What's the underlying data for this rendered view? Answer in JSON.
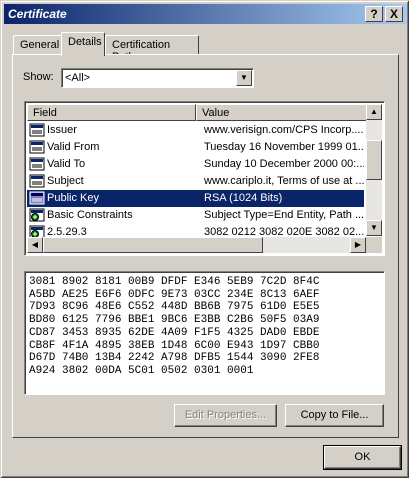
{
  "window": {
    "title": "Certificate",
    "help_button": "?",
    "close_button": "X"
  },
  "tabs": [
    {
      "label": "General"
    },
    {
      "label": "Details"
    },
    {
      "label": "Certification Path"
    }
  ],
  "show": {
    "label": "Show:",
    "value": "<All>"
  },
  "list": {
    "columns": [
      "Field",
      "Value"
    ],
    "rows": [
      {
        "field": "Issuer",
        "value": "www.verisign.com/CPS Incorp....",
        "icon": "document-icon"
      },
      {
        "field": "Valid From",
        "value": "Tuesday 16 November 1999 01...",
        "icon": "document-icon"
      },
      {
        "field": "Valid To",
        "value": "Sunday 10 December 2000 00:...",
        "icon": "document-icon"
      },
      {
        "field": "Subject",
        "value": "www.cariplo.it, Terms of use at ...",
        "icon": "document-icon"
      },
      {
        "field": "Public Key",
        "value": "RSA (1024 Bits)",
        "icon": "document-icon",
        "selected": true
      },
      {
        "field": "Basic Constraints",
        "value": "Subject Type=End Entity, Path ...",
        "icon": "extension-icon"
      },
      {
        "field": "2.5.29.3",
        "value": "3082 0212 3082 020E 3082 02...",
        "icon": "extension-icon"
      }
    ]
  },
  "hex_lines": [
    "3081 8902 8181 00B9 DFDF E346 5EB9 7C2D 8F4C",
    "A5BD AE25 E6F6 0DFC 9E73 03CC 234E 8C13 6AEF",
    "7D93 8C96 48E6 C552 448D BB6B 7975 61D0 E5E5",
    "BD80 6125 7796 BBE1 9BC6 E3BB C2B6 50F5 03A9",
    "CD87 3453 8935 62DE 4A09 F1F5 4325 DAD0 EBDE",
    "CB8F 4F1A 4895 38EB 1D48 6C00 E943 1D97 CBB0",
    "D67D 74B0 13B4 2242 A798 DFB5 1544 3090 2FE8",
    "A924 3802 00DA 5C01 0502 0301 0001"
  ],
  "buttons": {
    "edit": "Edit Properties...",
    "copy": "Copy to File...",
    "ok": "OK"
  }
}
